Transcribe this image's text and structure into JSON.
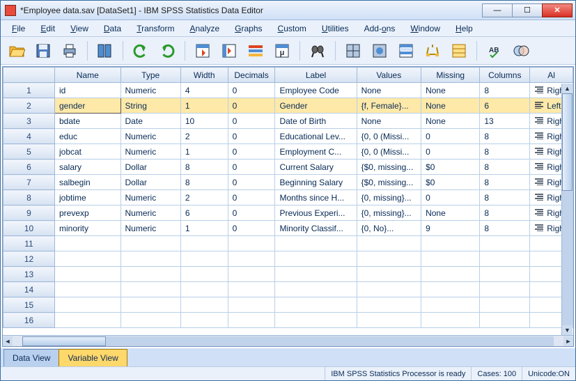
{
  "window": {
    "title": "*Employee data.sav [DataSet1] - IBM SPSS Statistics Data Editor"
  },
  "menu": {
    "file": "File",
    "edit": "Edit",
    "view": "View",
    "data": "Data",
    "transform": "Transform",
    "analyze": "Analyze",
    "graphs": "Graphs",
    "custom": "Custom",
    "utilities": "Utilities",
    "addons": "Add-ons",
    "window": "Window",
    "help": "Help"
  },
  "columns": {
    "name": "Name",
    "type": "Type",
    "width": "Width",
    "decimals": "Decimals",
    "label": "Label",
    "values": "Values",
    "missing": "Missing",
    "columns": "Columns",
    "align": "Al"
  },
  "rows": [
    {
      "n": "1",
      "name": "id",
      "type": "Numeric",
      "width": "4",
      "dec": "0",
      "label": "Employee Code",
      "values": "None",
      "missing": "None",
      "cols": "8",
      "align": "Righ"
    },
    {
      "n": "2",
      "name": "gender",
      "type": "String",
      "width": "1",
      "dec": "0",
      "label": "Gender",
      "values": "{f, Female}...",
      "missing": "None",
      "cols": "6",
      "align": "Left",
      "selected": true
    },
    {
      "n": "3",
      "name": "bdate",
      "type": "Date",
      "width": "10",
      "dec": "0",
      "label": "Date of Birth",
      "values": "None",
      "missing": "None",
      "cols": "13",
      "align": "Righ"
    },
    {
      "n": "4",
      "name": "educ",
      "type": "Numeric",
      "width": "2",
      "dec": "0",
      "label": "Educational Lev...",
      "values": "{0, 0 (Missi...",
      "missing": "0",
      "cols": "8",
      "align": "Righ"
    },
    {
      "n": "5",
      "name": "jobcat",
      "type": "Numeric",
      "width": "1",
      "dec": "0",
      "label": "Employment C...",
      "values": "{0, 0 (Missi...",
      "missing": "0",
      "cols": "8",
      "align": "Righ"
    },
    {
      "n": "6",
      "name": "salary",
      "type": "Dollar",
      "width": "8",
      "dec": "0",
      "label": "Current Salary",
      "values": "{$0, missing...",
      "missing": "$0",
      "cols": "8",
      "align": "Righ"
    },
    {
      "n": "7",
      "name": "salbegin",
      "type": "Dollar",
      "width": "8",
      "dec": "0",
      "label": "Beginning Salary",
      "values": "{$0, missing...",
      "missing": "$0",
      "cols": "8",
      "align": "Righ"
    },
    {
      "n": "8",
      "name": "jobtime",
      "type": "Numeric",
      "width": "2",
      "dec": "0",
      "label": "Months since H...",
      "values": "{0, missing}...",
      "missing": "0",
      "cols": "8",
      "align": "Righ"
    },
    {
      "n": "9",
      "name": "prevexp",
      "type": "Numeric",
      "width": "6",
      "dec": "0",
      "label": "Previous Experi...",
      "values": "{0, missing}...",
      "missing": "None",
      "cols": "8",
      "align": "Righ"
    },
    {
      "n": "10",
      "name": "minority",
      "type": "Numeric",
      "width": "1",
      "dec": "0",
      "label": "Minority Classif...",
      "values": "{0, No}...",
      "missing": "9",
      "cols": "8",
      "align": "Righ"
    }
  ],
  "emptyRows": [
    "11",
    "12",
    "13",
    "14",
    "15",
    "16"
  ],
  "tabs": {
    "data": "Data View",
    "variable": "Variable View"
  },
  "status": {
    "processor": "IBM SPSS Statistics Processor is ready",
    "cases": "Cases: 100",
    "unicode": "Unicode:ON"
  }
}
